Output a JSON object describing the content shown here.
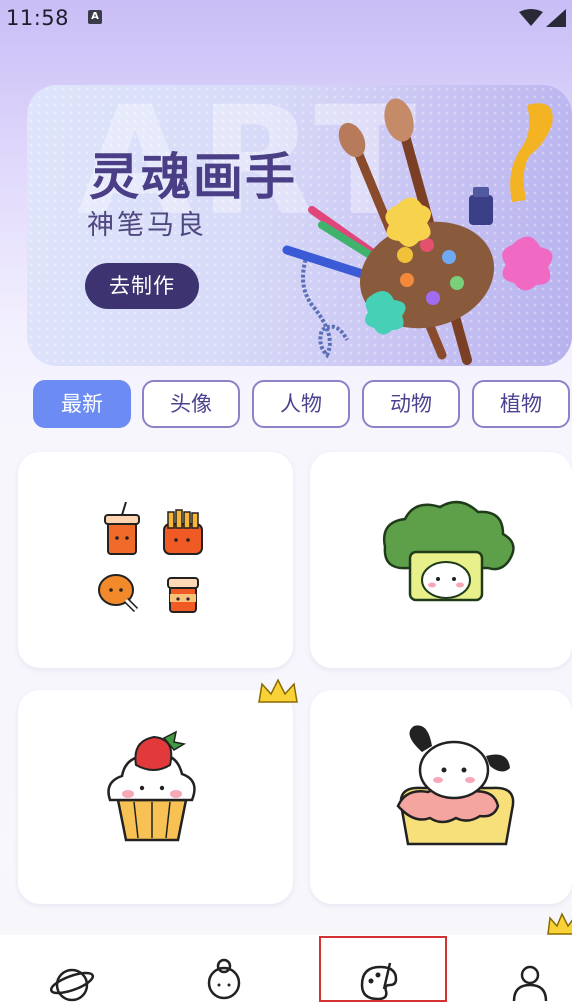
{
  "status_bar": {
    "time": "11:58",
    "notification_icon": "A"
  },
  "banner": {
    "title": "灵魂画手",
    "subtitle": "神笔马良",
    "button_label": "去制作",
    "background_text": "ART"
  },
  "tabs": [
    {
      "label": "最新",
      "active": true
    },
    {
      "label": "头像",
      "active": false
    },
    {
      "label": "人物",
      "active": false
    },
    {
      "label": "动物",
      "active": false
    },
    {
      "label": "植物",
      "active": false
    }
  ],
  "cards": [
    {
      "name": "fast-food-drawing",
      "premium": false
    },
    {
      "name": "broccoli-dog-drawing",
      "premium": false
    },
    {
      "name": "strawberry-cupcake-drawing",
      "premium": true
    },
    {
      "name": "dog-on-cake-drawing",
      "premium": false
    }
  ],
  "bottom_nav": [
    {
      "name": "planet-icon",
      "selected": false
    },
    {
      "name": "character-icon",
      "selected": false
    },
    {
      "name": "palette-icon",
      "selected": true
    },
    {
      "name": "profile-icon",
      "selected": false
    }
  ],
  "colors": {
    "accent": "#6c8cf3",
    "tab_border": "#8b82c8",
    "banner_button": "#3d3370",
    "selection_box": "#d33232"
  }
}
